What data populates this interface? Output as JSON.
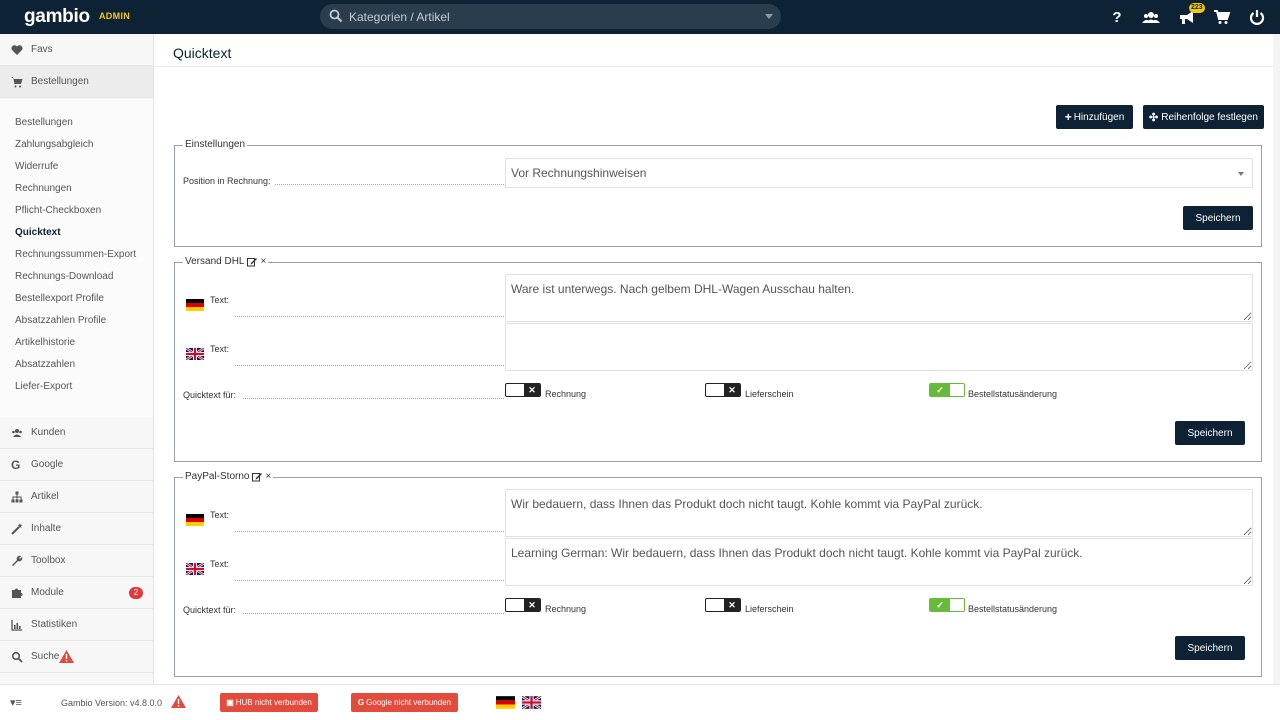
{
  "topbar": {
    "logo": "gambio",
    "logo_admin": "ADMIN",
    "search_placeholder": "Kategorien / Artikel",
    "notification_count": "223"
  },
  "sidebar": {
    "favs": "Favs",
    "orders": "Bestellungen",
    "sub_items": [
      "Bestellungen",
      "Zahlungsabgleich",
      "Widerrufe",
      "Rechnungen",
      "Pflicht-Checkboxen",
      "Quicktext",
      "Rechnungssummen-Export",
      "Rechnungs-Download",
      "Bestellexport Profile",
      "Absatzzahlen Profile",
      "Artikelhistorie",
      "Absatzzahlen",
      "Liefer-Export"
    ],
    "items": [
      "Kunden",
      "Google",
      "Artikel",
      "Inhalte",
      "Toolbox",
      "Module",
      "Statistiken",
      "Suche"
    ],
    "module_badge": "2"
  },
  "page": {
    "title": "Quicktext",
    "add_button": "Hinzufügen",
    "order_button": "Reihenfolge festlegen"
  },
  "settings": {
    "legend": "Einstellungen",
    "position_label": "Position in Rechnung:",
    "position_value": "Vor Rechnungshinweisen",
    "save": "Speichern"
  },
  "blocks": [
    {
      "legend": "Versand DHL",
      "text_label_de": "Text:",
      "text_de": "Ware ist unterwegs. Nach gelbem DHL-Wagen Ausschau halten.",
      "text_label_en": "Text:",
      "text_en": "",
      "for_label": "Quicktext für:",
      "opt_invoice": "Rechnung",
      "opt_delivery": "Lieferschein",
      "opt_status": "Bestellstatusänderung",
      "save": "Speichern"
    },
    {
      "legend": "PayPal-Storno",
      "text_label_de": "Text:",
      "text_de": "Wir bedauern, dass Ihnen das Produkt doch nicht taugt. Kohle kommt via PayPal zurück.",
      "text_label_en": "Text:",
      "text_en": "Learning German: Wir bedauern, dass Ihnen das Produkt doch nicht taugt. Kohle kommt via PayPal zurück.",
      "for_label": "Quicktext für:",
      "opt_invoice": "Rechnung",
      "opt_delivery": "Lieferschein",
      "opt_status": "Bestellstatusänderung",
      "save": "Speichern"
    }
  ],
  "footer": {
    "version": "Gambio Version: v4.8.0.0",
    "hub": "HUB nicht verbunden",
    "google": "Google nicht verbunden"
  },
  "colors": {
    "brand_dark": "#0d2234",
    "accent_yellow": "#f3c80f",
    "toggle_on": "#66bb3a",
    "alert_red": "#e34b3d"
  }
}
